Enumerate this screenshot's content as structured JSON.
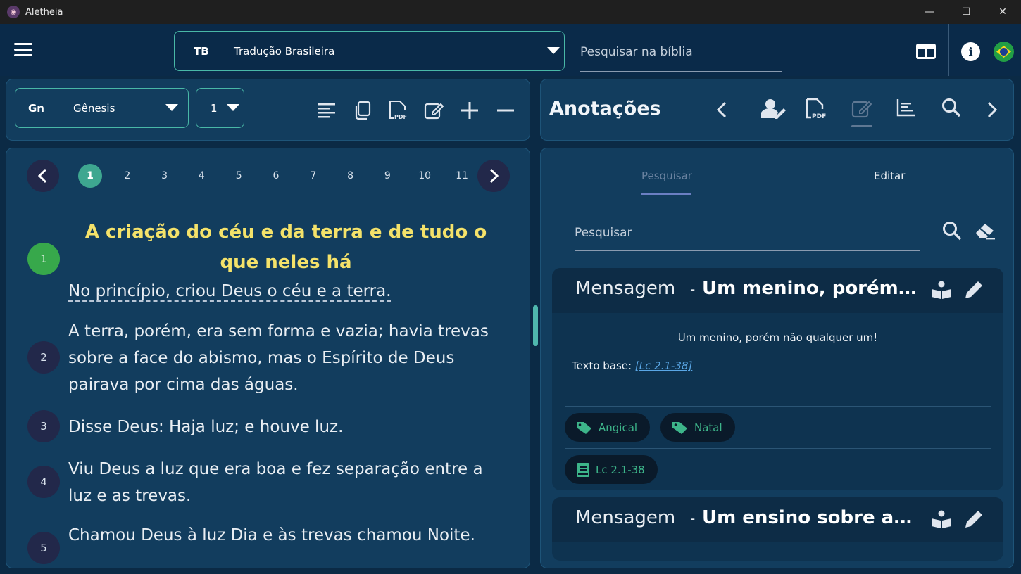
{
  "window": {
    "title": "Aletheia",
    "minimize": "—",
    "maximize": "☐",
    "close": "✕"
  },
  "topbar": {
    "version_abbr": "TB",
    "version_name": "Tradução Brasileira",
    "search_placeholder": "Pesquisar na bíblia"
  },
  "book_bar": {
    "book_abbr": "Gn",
    "book_name": "Gênesis",
    "chapter": "1"
  },
  "chapters": [
    "1",
    "2",
    "3",
    "4",
    "5",
    "6",
    "7",
    "8",
    "9",
    "10",
    "11"
  ],
  "reader": {
    "heading": "A criação do céu e da terra e de tudo o que neles há",
    "verses": [
      {
        "num": "1",
        "text": "No princípio, criou Deus o céu e a terra."
      },
      {
        "num": "2",
        "text": "A terra, porém, era sem forma e vazia; havia trevas sobre a face do abismo, mas o Espírito de Deus pairava por cima das águas."
      },
      {
        "num": "3",
        "text": "Disse Deus: Haja luz; e houve luz."
      },
      {
        "num": "4",
        "text": "Viu Deus a luz que era boa e fez separação entre a luz e as trevas."
      },
      {
        "num": "5",
        "text": "Chamou Deus à luz Dia e às trevas chamou Noite."
      }
    ]
  },
  "notes": {
    "title": "Anotações",
    "tabs": {
      "search": "Pesquisar",
      "edit": "Editar"
    },
    "search_placeholder": "Pesquisar",
    "cards": [
      {
        "type": "Mensagem",
        "dash": "-",
        "title": "Um menino, porém não qualquer um!",
        "subtitle": "Um menino, porém não qualquer um!",
        "base_label": "Texto base: ",
        "base_ref": "[Lc 2.1-38]",
        "tags": [
          "Angical",
          "Natal"
        ],
        "refs": [
          "Lc 2.1-38"
        ]
      },
      {
        "type": "Mensagem",
        "dash": "-",
        "title": "Um ensino sobre a justiça"
      }
    ]
  },
  "colors": {
    "accent": "#49b8a7",
    "heading": "#f4e26a",
    "chip_text": "#3db58a"
  }
}
